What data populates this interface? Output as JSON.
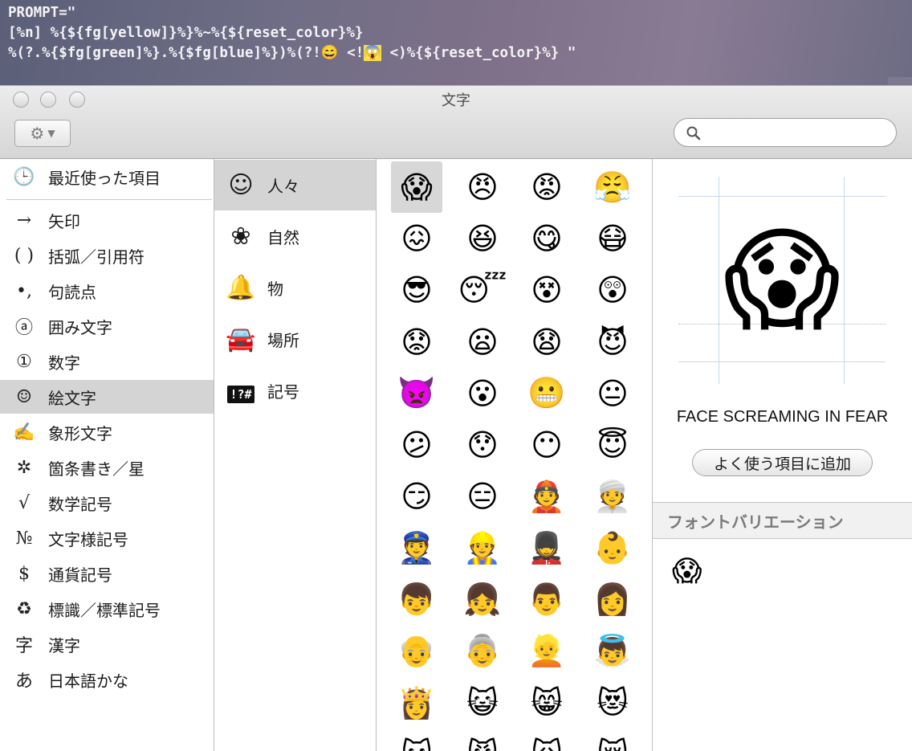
{
  "terminal": {
    "line1": "PROMPT=\"",
    "line2": "[%n] %{${fg[yellow]}%}%~%{${reset_color}%}",
    "line3_before": "%(?.%{$fg[green]%}.%{$fg[blue]%})%(?!😄 <!",
    "line3_cursor": "😱",
    "line3_after": " <)%{${reset_color}%} \""
  },
  "window": {
    "title": "文字",
    "search_placeholder": ""
  },
  "categories": [
    {
      "icon": "🕒",
      "label": "最近使った項目"
    },
    {
      "icon": "→",
      "label": "矢印"
    },
    {
      "icon": "( )",
      "label": "括弧／引用符"
    },
    {
      "icon": "•,",
      "label": "句読点"
    },
    {
      "icon": "ⓐ",
      "label": "囲み文字"
    },
    {
      "icon": "①",
      "label": "数字"
    },
    {
      "icon": "☺",
      "label": "絵文字"
    },
    {
      "icon": "✍",
      "label": "象形文字"
    },
    {
      "icon": "✲",
      "label": "箇条書き／星"
    },
    {
      "icon": "√",
      "label": "数学記号"
    },
    {
      "icon": "№",
      "label": "文字様記号"
    },
    {
      "icon": "$",
      "label": "通貨記号"
    },
    {
      "icon": "♻",
      "label": "標識／標準記号"
    },
    {
      "icon": "字",
      "label": "漢字"
    },
    {
      "icon": "あ",
      "label": "日本語かな"
    }
  ],
  "selected_category": "絵文字",
  "subcategories": [
    {
      "icon": "☺",
      "label": "人々"
    },
    {
      "icon": "❀",
      "label": "自然"
    },
    {
      "icon": "🔔",
      "label": "物"
    },
    {
      "icon": "🚘",
      "label": "場所"
    },
    {
      "icon": "!?#",
      "label": "記号"
    }
  ],
  "selected_subcategory": "人々",
  "emoji_grid": [
    [
      "😱",
      "😠",
      "😡",
      "😤"
    ],
    [
      "😖",
      "😆",
      "😋",
      "😷"
    ],
    [
      "😎",
      "😴",
      "😵",
      "😲"
    ],
    [
      "😟",
      "😦",
      "😧",
      "😈"
    ],
    [
      "👿",
      "😮",
      "😬",
      "😐"
    ],
    [
      "😕",
      "😯",
      "😶",
      "😇"
    ],
    [
      "😏",
      "😑",
      "👲",
      "👳"
    ],
    [
      "👮",
      "👷",
      "💂",
      "👶"
    ],
    [
      "👦",
      "👧",
      "👨",
      "👩"
    ],
    [
      "👴",
      "👵",
      "👱",
      "👼"
    ],
    [
      "👸",
      "😺",
      "😸",
      "😻"
    ],
    [
      "😽",
      "😼",
      "🙀",
      "😿"
    ]
  ],
  "selected_emoji": "😱",
  "detail": {
    "glyph": "😱",
    "name": "FACE SCREAMING IN FEAR",
    "add_favorite": "よく使う項目に追加",
    "variations_heading": "フォントバリエーション",
    "variations": [
      "😱"
    ]
  }
}
